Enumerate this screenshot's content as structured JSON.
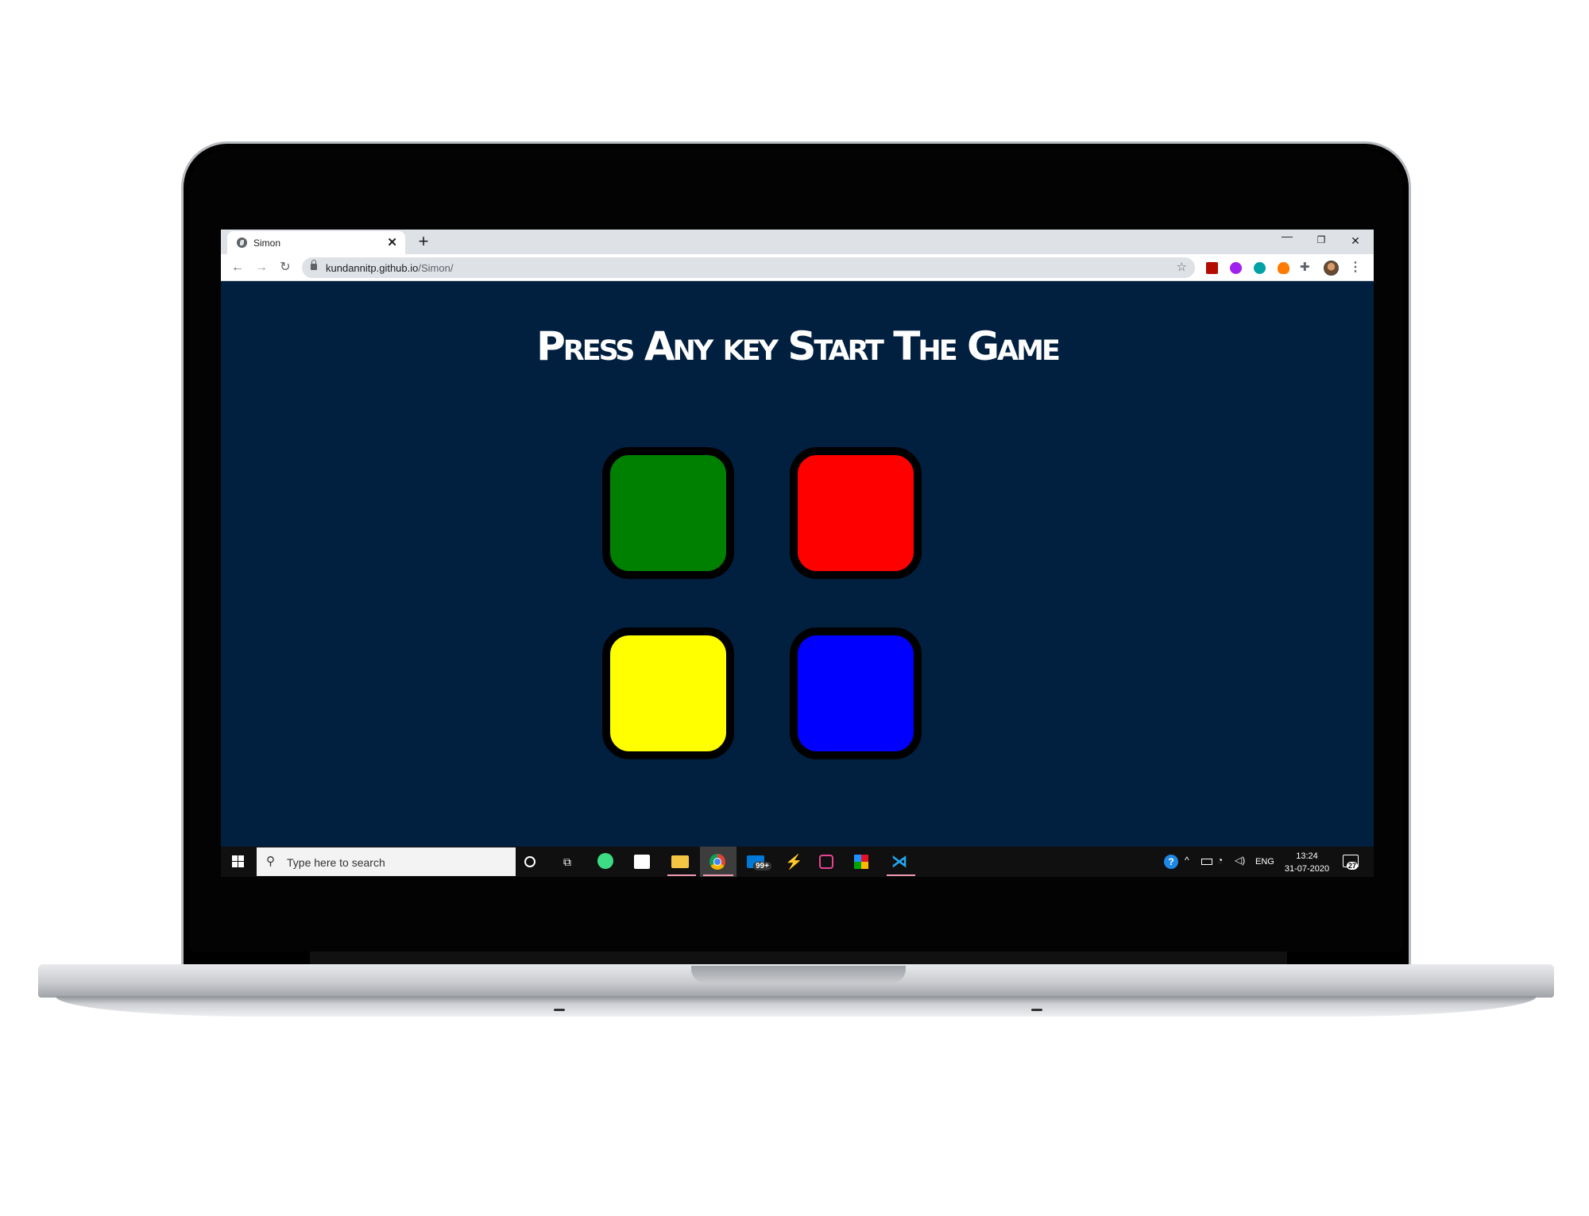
{
  "browser": {
    "tab_title": "Simon",
    "tab_close": "✕",
    "new_tab": "+",
    "url_host": "kundannitp.github.io",
    "url_path": "/Simon/",
    "window_controls": {
      "minimize": "—",
      "maximize": "❐",
      "close": "✕"
    }
  },
  "game": {
    "title": "Press Any key Start The Game",
    "buttons": [
      {
        "id": "green",
        "color": "#008000"
      },
      {
        "id": "red",
        "color": "#ff0000"
      },
      {
        "id": "yellow",
        "color": "#ffff00"
      },
      {
        "id": "blue",
        "color": "#0000ff"
      }
    ],
    "background_color": "#011f3f"
  },
  "taskbar": {
    "search_placeholder": "Type here to search",
    "mail_badge": "99+",
    "language": "ENG",
    "time": "13:24",
    "date": "31-07-2020",
    "notification_count": "27",
    "pinned_icons": [
      "cortana-icon",
      "task-view-icon",
      "android-studio-icon",
      "store-icon",
      "file-explorer-icon",
      "chrome-icon",
      "mail-icon",
      "visual-studio-icon",
      "terminal-icon",
      "tiles-app-icon",
      "vscode-icon"
    ]
  }
}
